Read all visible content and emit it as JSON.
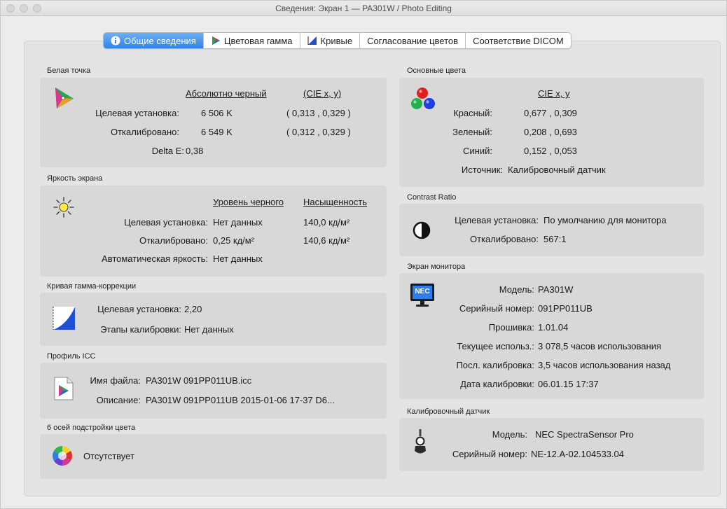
{
  "window": {
    "title": "Сведения: Экран 1 — PA301W / Photo Editing"
  },
  "tabs": [
    {
      "label": "Общие сведения",
      "icon": "info-icon",
      "active": true
    },
    {
      "label": "Цветовая гамма",
      "icon": "gamut-triangle-icon",
      "active": false
    },
    {
      "label": "Кривые",
      "icon": "curve-icon",
      "active": false
    },
    {
      "label": "Согласование цветов",
      "icon": "",
      "active": false
    },
    {
      "label": "Соответствие DICOM",
      "icon": "",
      "active": false
    }
  ],
  "white_point": {
    "title": "Белая точка",
    "col_header_1": "Абсолютно черный",
    "col_header_2": "(CIE x, y)",
    "target_label": "Целевая установка:",
    "target_temp": "6 506 K",
    "target_cie": "( 0,313 , 0,329 )",
    "calibrated_label": "Откалибровано:",
    "calibrated_temp": "6 549 K",
    "calibrated_cie": "( 0,312 , 0,329 )",
    "delta_label": "Delta E:",
    "delta_value": "0,38"
  },
  "brightness": {
    "title": "Яркость экрана",
    "col_header_1": "Уровень черного",
    "col_header_2": "Насыщенность",
    "target_label": "Целевая установка:",
    "target_black": "Нет данных",
    "target_sat": "140,0 кд/м²",
    "calibrated_label": "Откалибровано:",
    "calibrated_black": "0,25 кд/м²",
    "calibrated_sat": "140,6 кд/м²",
    "auto_label": "Автоматическая яркость:",
    "auto_value": "Нет данных"
  },
  "gamma": {
    "title": "Кривая гамма-коррекции",
    "target_label": "Целевая установка:",
    "target_value": "2,20",
    "steps_label": "Этапы калибровки:",
    "steps_value": "Нет данных"
  },
  "icc": {
    "title": "Профиль ICC",
    "file_label": "Имя файла:",
    "file_value": "PA301W 091PP011UB.icc",
    "desc_label": "Описание:",
    "desc_value": "PA301W 091PP011UB 2015-01-06 17-37 D6..."
  },
  "six_axis": {
    "title": "6 осей подстройки цвета",
    "value": "Отсутствует"
  },
  "primaries": {
    "title": "Основные цвета",
    "col_header": "CIE x, y",
    "red_label": "Красный:",
    "red_value": "0,677 , 0,309",
    "green_label": "Зеленый:",
    "green_value": "0,208 , 0,693",
    "blue_label": "Синий:",
    "blue_value": "0,152 , 0,053",
    "source_label": "Источник:",
    "source_value": "Калибровочный датчик"
  },
  "contrast": {
    "title": "Contrast Ratio",
    "target_label": "Целевая установка:",
    "target_value": "По умолчанию для монитора",
    "calibrated_label": "Откалибровано:",
    "calibrated_value": "567:1"
  },
  "monitor": {
    "title": "Экран монитора",
    "icon_text": "NEC",
    "model_label": "Модель:",
    "model_value": "PA301W",
    "serial_label": "Серийный номер:",
    "serial_value": "091PP011UB",
    "firmware_label": "Прошивка:",
    "firmware_value": "1.01.04",
    "usage_label": "Текущее использ.:",
    "usage_value": "3 078,5 часов использования",
    "last_cal_label": "Посл. калибровка:",
    "last_cal_value": "3,5 часов использования назад",
    "cal_date_label": "Дата калибровки:",
    "cal_date_value": "06.01.15 17:37"
  },
  "sensor": {
    "title": "Калибровочный датчик",
    "model_label": "Модель:",
    "model_value": "NEC SpectraSensor Pro",
    "serial_label": "Серийный номер:",
    "serial_value": "NE-12.A-02.104533.04"
  },
  "colors": {
    "tab_active_top": "#6ab0f6",
    "tab_active_bottom": "#2f83ea",
    "panel": "#d8d8d8",
    "content": "#e4e4e4"
  }
}
